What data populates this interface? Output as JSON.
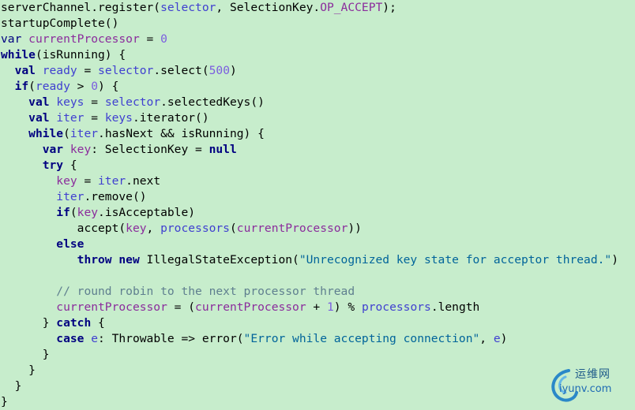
{
  "code_lines": [
    [
      [
        "serverChannel",
        "p"
      ],
      [
        ".register(",
        "p"
      ],
      [
        "selector",
        "v"
      ],
      [
        ", SelectionKey.",
        "p"
      ],
      [
        "OP_ACCEPT",
        "f"
      ],
      [
        ");",
        "p"
      ]
    ],
    [
      [
        "startupComplete()",
        "p"
      ]
    ],
    [
      [
        "var ",
        "kwr"
      ],
      [
        "currentProcessor",
        "f"
      ],
      [
        " = ",
        "p"
      ],
      [
        "0",
        "n"
      ]
    ],
    [
      [
        "while",
        "kw"
      ],
      [
        "(isRunning) {",
        "p"
      ]
    ],
    [
      [
        "  ",
        "p"
      ],
      [
        "val ",
        "kw"
      ],
      [
        "ready",
        "v"
      ],
      [
        " = ",
        "p"
      ],
      [
        "selector",
        "v"
      ],
      [
        ".select(",
        "p"
      ],
      [
        "500",
        "n"
      ],
      [
        ")",
        "p"
      ]
    ],
    [
      [
        "  ",
        "p"
      ],
      [
        "if",
        "kw"
      ],
      [
        "(",
        "p"
      ],
      [
        "ready",
        "v"
      ],
      [
        " > ",
        "p"
      ],
      [
        "0",
        "n"
      ],
      [
        ") {",
        "p"
      ]
    ],
    [
      [
        "    ",
        "p"
      ],
      [
        "val ",
        "kw"
      ],
      [
        "keys",
        "v"
      ],
      [
        " = ",
        "p"
      ],
      [
        "selector",
        "v"
      ],
      [
        ".selectedKeys()",
        "p"
      ]
    ],
    [
      [
        "    ",
        "p"
      ],
      [
        "val ",
        "kw"
      ],
      [
        "iter",
        "v"
      ],
      [
        " = ",
        "p"
      ],
      [
        "keys",
        "v"
      ],
      [
        ".iterator()",
        "p"
      ]
    ],
    [
      [
        "    ",
        "p"
      ],
      [
        "while",
        "kw"
      ],
      [
        "(",
        "p"
      ],
      [
        "iter",
        "v"
      ],
      [
        ".hasNext && isRunning) {",
        "p"
      ]
    ],
    [
      [
        "      ",
        "p"
      ],
      [
        "var ",
        "kw"
      ],
      [
        "key",
        "f"
      ],
      [
        ": SelectionKey = ",
        "p"
      ],
      [
        "null",
        "kw"
      ]
    ],
    [
      [
        "      ",
        "p"
      ],
      [
        "try",
        "kw"
      ],
      [
        " {",
        "p"
      ]
    ],
    [
      [
        "        ",
        "p"
      ],
      [
        "key",
        "f"
      ],
      [
        " = ",
        "p"
      ],
      [
        "iter",
        "v"
      ],
      [
        ".next",
        "p"
      ]
    ],
    [
      [
        "        ",
        "p"
      ],
      [
        "iter",
        "v"
      ],
      [
        ".remove()",
        "p"
      ]
    ],
    [
      [
        "        ",
        "p"
      ],
      [
        "if",
        "kw"
      ],
      [
        "(",
        "p"
      ],
      [
        "key",
        "f"
      ],
      [
        ".isAcceptable)",
        "p"
      ]
    ],
    [
      [
        "           ",
        "p"
      ],
      [
        "accept(",
        "p"
      ],
      [
        "key",
        "f"
      ],
      [
        ", ",
        "p"
      ],
      [
        "processors",
        "v"
      ],
      [
        "(",
        "p"
      ],
      [
        "currentProcessor",
        "f"
      ],
      [
        "))",
        "p"
      ]
    ],
    [
      [
        "        ",
        "p"
      ],
      [
        "else",
        "kw"
      ]
    ],
    [
      [
        "           ",
        "p"
      ],
      [
        "throw new ",
        "kw"
      ],
      [
        "IllegalStateException(",
        "p"
      ],
      [
        "\"Unrecognized key state for acceptor thread.\"",
        "s"
      ],
      [
        ")",
        "p"
      ]
    ],
    [
      [
        "",
        "p"
      ]
    ],
    [
      [
        "        ",
        "p"
      ],
      [
        "// round robin to the next processor thread",
        "c"
      ]
    ],
    [
      [
        "        ",
        "p"
      ],
      [
        "currentProcessor",
        "f"
      ],
      [
        " = (",
        "p"
      ],
      [
        "currentProcessor",
        "f"
      ],
      [
        " + ",
        "p"
      ],
      [
        "1",
        "n"
      ],
      [
        ") % ",
        "p"
      ],
      [
        "processors",
        "v"
      ],
      [
        ".length",
        "p"
      ]
    ],
    [
      [
        "      ",
        "p"
      ],
      [
        "} ",
        "p"
      ],
      [
        "catch",
        "kw"
      ],
      [
        " {",
        "p"
      ]
    ],
    [
      [
        "        ",
        "p"
      ],
      [
        "case ",
        "kw"
      ],
      [
        "e",
        "v"
      ],
      [
        ": Throwable => error(",
        "p"
      ],
      [
        "\"Error while accepting connection\"",
        "s"
      ],
      [
        ", ",
        "p"
      ],
      [
        "e",
        "v"
      ],
      [
        ")",
        "p"
      ]
    ],
    [
      [
        "      }",
        "p"
      ]
    ],
    [
      [
        "    }",
        "p"
      ]
    ],
    [
      [
        "  }",
        "p"
      ]
    ],
    [
      [
        "}",
        "p"
      ]
    ]
  ],
  "watermark": {
    "chinese": "运维网",
    "domain": "iyunv.com"
  }
}
